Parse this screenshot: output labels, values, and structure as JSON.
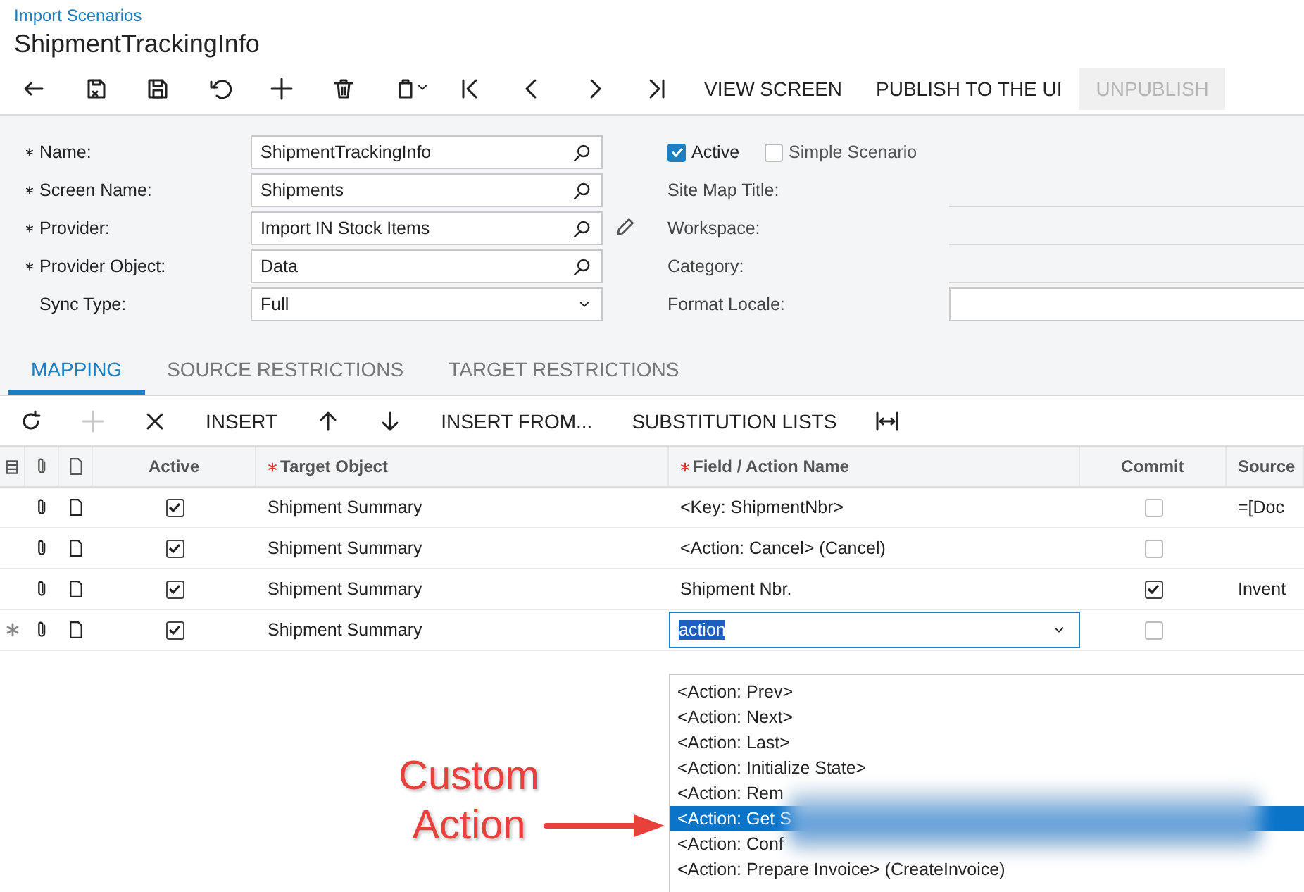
{
  "breadcrumb": "Import Scenarios",
  "title": "ShipmentTrackingInfo",
  "toolbar": [
    {
      "kind": "back",
      "disabled": false
    },
    {
      "kind": "save-close",
      "disabled": false
    },
    {
      "kind": "save",
      "disabled": false
    },
    {
      "kind": "undo",
      "disabled": false
    },
    {
      "kind": "add",
      "disabled": false
    },
    {
      "kind": "delete",
      "disabled": false
    },
    {
      "kind": "copy",
      "disabled": false
    },
    {
      "kind": "first",
      "disabled": false
    },
    {
      "kind": "prev",
      "disabled": false
    },
    {
      "kind": "next",
      "disabled": false
    },
    {
      "kind": "last",
      "disabled": false
    },
    {
      "kind": "text",
      "label": "VIEW SCREEN",
      "disabled": false
    },
    {
      "kind": "text",
      "label": "PUBLISH TO THE UI",
      "disabled": false
    },
    {
      "kind": "text",
      "label": "UNPUBLISH",
      "disabled": true
    }
  ],
  "form": {
    "fields": [
      {
        "label": "Name:",
        "required": true,
        "value": "ShipmentTrackingInfo",
        "kind": "lookup",
        "edit": false
      },
      {
        "label": "Screen Name:",
        "required": true,
        "value": "Shipments",
        "kind": "lookup",
        "edit": false
      },
      {
        "label": "Provider:",
        "required": true,
        "value": "Import IN Stock Items",
        "kind": "lookup",
        "edit": true
      },
      {
        "label": "Provider Object:",
        "required": true,
        "value": "Data",
        "kind": "lookup",
        "edit": false
      },
      {
        "label": "Sync Type:",
        "required": false,
        "value": "Full",
        "kind": "select",
        "edit": false
      }
    ],
    "checkboxes": [
      {
        "label": "Active",
        "checked": true
      },
      {
        "label": "Simple Scenario",
        "checked": false
      }
    ],
    "right_fields": [
      {
        "label": "Site Map Title:",
        "kind": "line"
      },
      {
        "label": "Workspace:",
        "kind": "line"
      },
      {
        "label": "Category:",
        "kind": "line"
      },
      {
        "label": "Format Locale:",
        "kind": "box"
      }
    ]
  },
  "tabs": [
    {
      "label": "MAPPING",
      "selected": true
    },
    {
      "label": "SOURCE RESTRICTIONS",
      "selected": false
    },
    {
      "label": "TARGET RESTRICTIONS",
      "selected": false
    }
  ],
  "grid_toolbar": [
    {
      "kind": "refresh",
      "disabled": false
    },
    {
      "kind": "add",
      "disabled": true
    },
    {
      "kind": "delete",
      "disabled": false
    },
    {
      "kind": "text",
      "label": "INSERT",
      "disabled": false
    },
    {
      "kind": "up",
      "disabled": false
    },
    {
      "kind": "down",
      "disabled": false
    },
    {
      "kind": "text",
      "label": "INSERT FROM...",
      "disabled": false
    },
    {
      "kind": "text",
      "label": "SUBSTITUTION LISTS",
      "disabled": false
    },
    {
      "kind": "fit",
      "disabled": false
    }
  ],
  "grid": {
    "columns": [
      {
        "label": "Active",
        "required": false
      },
      {
        "label": "Target Object",
        "required": true
      },
      {
        "label": "Field / Action Name",
        "required": true
      },
      {
        "label": "Commit",
        "required": false
      },
      {
        "label": "Source",
        "required": false
      }
    ],
    "rows": [
      {
        "new": false,
        "active": true,
        "target_object": "Shipment Summary",
        "field": "<Key: ShipmentNbr>",
        "editing": false,
        "commit": false,
        "source": "=[Doc"
      },
      {
        "new": false,
        "active": true,
        "target_object": "Shipment Summary",
        "field": "<Action: Cancel> (Cancel)",
        "editing": false,
        "commit": false
      },
      {
        "new": false,
        "active": true,
        "target_object": "Shipment Summary",
        "field": "Shipment Nbr.",
        "editing": false,
        "commit": true,
        "source": "Invent"
      },
      {
        "new": true,
        "active": true,
        "target_object": "Shipment Summary",
        "field": "action",
        "editing": true,
        "commit": false
      }
    ]
  },
  "dropdown": {
    "items": [
      {
        "label": "<Action: Prev>",
        "selected": false
      },
      {
        "label": "<Action: Next>",
        "selected": false
      },
      {
        "label": "<Action: Last>",
        "selected": false
      },
      {
        "label": "<Action: Initialize State>",
        "selected": false
      },
      {
        "label": "<Action: Rem",
        "selected": false
      },
      {
        "label": "<Action: Get S",
        "selected": true
      },
      {
        "label": "<Action: Conf",
        "selected": false
      },
      {
        "label": "<Action: Prepare Invoice> (CreateInvoice)",
        "selected": false
      }
    ]
  },
  "annotation": {
    "text": "Custom Action"
  }
}
